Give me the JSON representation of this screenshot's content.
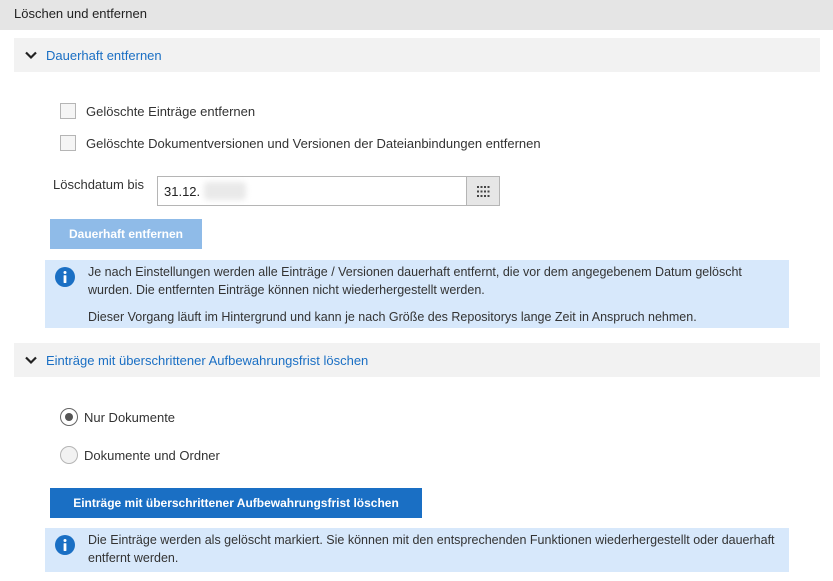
{
  "page": {
    "title": "Löschen und entfernen"
  },
  "section_remove": {
    "header": "Dauerhaft entfernen",
    "checkbox_entries": "Gelöschte Einträge entfernen",
    "checkbox_versions": "Gelöschte Dokumentversionen und Versionen der Dateianbindungen entfernen",
    "date_label": "Löschdatum bis",
    "date_value": "31.12.",
    "button": "Dauerhaft entfernen",
    "info_line1": "Je nach Einstellungen werden alle Einträge / Versionen dauerhaft entfernt, die vor dem angegebenem Datum gelöscht wurden. Die entfernten Einträge können nicht wiederhergestellt werden.",
    "info_line2": "Dieser Vorgang läuft im Hintergrund und kann je nach Größe des Repositorys lange Zeit in Anspruch nehmen."
  },
  "section_retention": {
    "header": "Einträge mit überschrittener Aufbewahrungsfrist löschen",
    "radio_documents": "Nur Dokumente",
    "radio_documents_folders": "Dokumente und Ordner",
    "selected": "Nur Dokumente",
    "button": "Einträge mit überschrittener Aufbewahrungsfrist löschen",
    "info": "Die Einträge werden als gelöscht markiert. Sie können mit den entsprechenden Funktionen wiederhergestellt oder dauerhaft entfernt werden."
  },
  "colors": {
    "accent": "#1a6fc4",
    "info_background": "#d7e8fb",
    "disabled_button": "#8fbbe8"
  }
}
